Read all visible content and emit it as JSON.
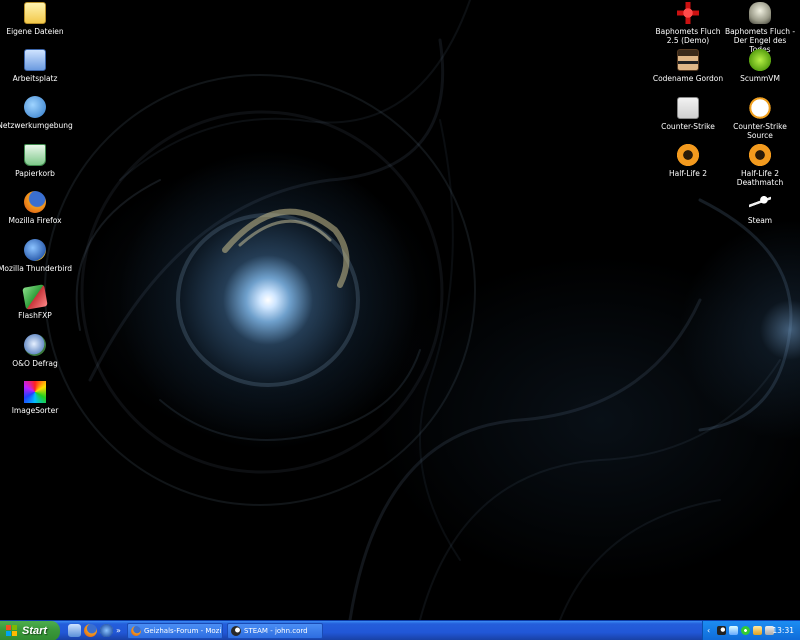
{
  "desktop": {
    "left_icons": [
      {
        "label": "Eigene Dateien",
        "icon": "my-documents-icon"
      },
      {
        "label": "Arbeitsplatz",
        "icon": "my-computer-icon"
      },
      {
        "label": "Netzwerkumgebung",
        "icon": "network-places-icon"
      },
      {
        "label": "Papierkorb",
        "icon": "recycle-bin-icon"
      },
      {
        "label": "Mozilla Firefox",
        "icon": "firefox-icon"
      },
      {
        "label": "Mozilla Thunderbird",
        "icon": "thunderbird-icon"
      },
      {
        "label": "FlashFXP",
        "icon": "flashfxp-icon"
      },
      {
        "label": "O&O Defrag",
        "icon": "defrag-icon"
      },
      {
        "label": "ImageSorter",
        "icon": "imagesorter-icon"
      }
    ],
    "right_icons": [
      {
        "label": "Baphomets Fluch 2.5 (Demo)",
        "icon": "baphomets-fluch-icon"
      },
      {
        "label": "Baphomets Fluch - Der Engel des Todes",
        "icon": "engel-des-todes-icon"
      },
      {
        "label": "Codename Gordon",
        "icon": "codename-gordon-icon"
      },
      {
        "label": "ScummVM",
        "icon": "scummvm-icon"
      },
      {
        "label": "Counter-Strike",
        "icon": "counter-strike-icon"
      },
      {
        "label": "Counter-Strike Source",
        "icon": "counter-strike-source-icon"
      },
      {
        "label": "Half-Life 2",
        "icon": "half-life-2-icon"
      },
      {
        "label": "Half-Life 2 Deathmatch",
        "icon": "half-life-2-deathmatch-icon"
      },
      {
        "label": "Steam",
        "icon": "steam-icon"
      }
    ]
  },
  "taskbar": {
    "start_label": "Start",
    "quick_launch": [
      "show-desktop-icon",
      "firefox-icon",
      "thunderbird-icon"
    ],
    "tasks": [
      {
        "label": "Geizhals-Forum - Mozi...",
        "icon": "firefox-icon"
      },
      {
        "label": "STEAM - john.cord",
        "icon": "steam-icon"
      }
    ],
    "tray_icons": [
      "steam-tray-icon",
      "network-tray-icon",
      "icq-tray-icon",
      "security-tray-icon",
      "volume-tray-icon"
    ],
    "clock": "13:31"
  },
  "colors": {
    "taskbar": "#245edb",
    "start_button": "#3c9a3c",
    "tray": "#0f6ad8",
    "desktop": "#000000"
  }
}
